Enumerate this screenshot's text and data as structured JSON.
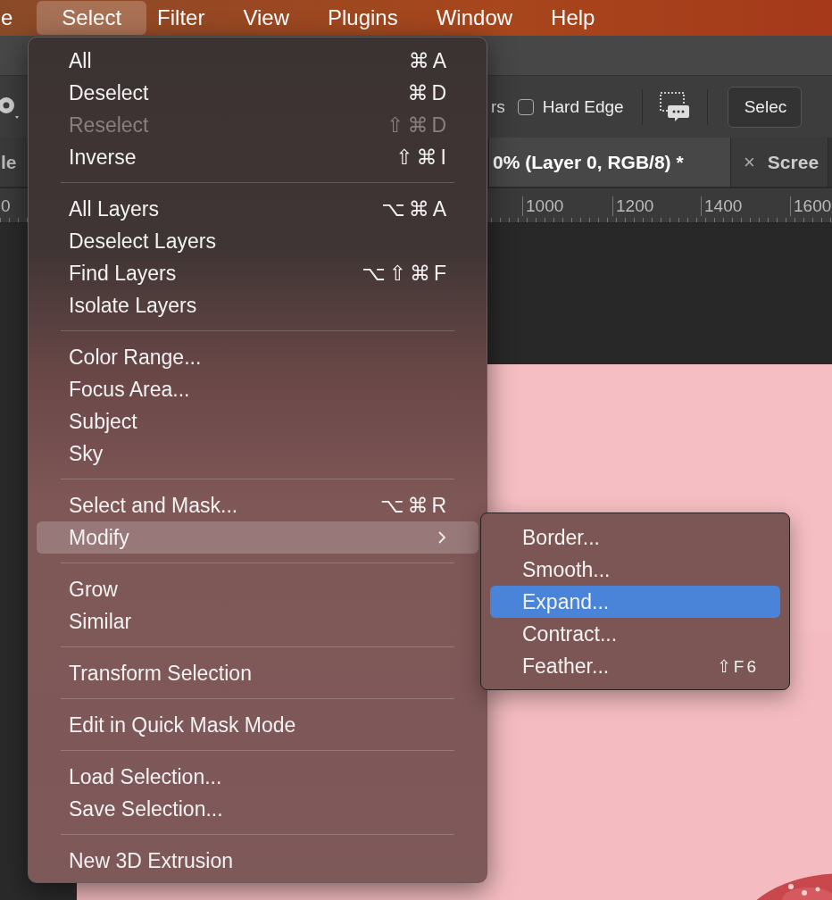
{
  "menu_bar": [
    {
      "label": "e",
      "selected": false
    },
    {
      "label": "Select",
      "selected": true
    },
    {
      "label": "Filter",
      "selected": false
    },
    {
      "label": "View",
      "selected": false
    },
    {
      "label": "Plugins",
      "selected": false
    },
    {
      "label": "Window",
      "selected": false
    },
    {
      "label": "Help",
      "selected": false
    }
  ],
  "options_bar": {
    "partial_label": "rs",
    "hard_edge": {
      "label": "Hard Edge",
      "checked": false
    },
    "button": "Selec"
  },
  "document_tabs": [
    {
      "label": "le",
      "selected": false
    },
    {
      "label": "0% (Layer 0, RGB/8) *",
      "selected": true
    },
    {
      "label": "Scree",
      "selected": false,
      "close": "×"
    }
  ],
  "ruler": [
    "0",
    "1000",
    "1200",
    "1400",
    "1600"
  ],
  "select_menu": [
    [
      {
        "label": "All",
        "shortcut": "⌘A",
        "disabled": false,
        "selected": false,
        "submenu": false
      },
      {
        "label": "Deselect",
        "shortcut": "⌘D",
        "disabled": false,
        "selected": false,
        "submenu": false
      },
      {
        "label": "Reselect",
        "shortcut": "⇧⌘D",
        "disabled": true,
        "selected": false,
        "submenu": false
      },
      {
        "label": "Inverse",
        "shortcut": "⇧⌘I",
        "disabled": false,
        "selected": false,
        "submenu": false
      }
    ],
    [
      {
        "label": "All Layers",
        "shortcut": "⌥⌘A",
        "disabled": false,
        "selected": false,
        "submenu": false
      },
      {
        "label": "Deselect Layers",
        "disabled": false,
        "selected": false,
        "submenu": false
      },
      {
        "label": "Find Layers",
        "shortcut": "⌥⇧⌘F",
        "disabled": false,
        "selected": false,
        "submenu": false
      },
      {
        "label": "Isolate Layers",
        "disabled": false,
        "selected": false,
        "submenu": false
      }
    ],
    [
      {
        "label": "Color Range...",
        "disabled": false,
        "selected": false,
        "submenu": false
      },
      {
        "label": "Focus Area...",
        "disabled": false,
        "selected": false,
        "submenu": false
      },
      {
        "label": "Subject",
        "disabled": false,
        "selected": false,
        "submenu": false
      },
      {
        "label": "Sky",
        "disabled": false,
        "selected": false,
        "submenu": false
      }
    ],
    [
      {
        "label": "Select and Mask...",
        "shortcut": "⌥⌘R",
        "disabled": false,
        "selected": false,
        "submenu": false
      },
      {
        "label": "Modify",
        "disabled": false,
        "selected": true,
        "submenu": true
      }
    ],
    [
      {
        "label": "Grow",
        "disabled": false,
        "selected": false,
        "submenu": false
      },
      {
        "label": "Similar",
        "disabled": false,
        "selected": false,
        "submenu": false
      }
    ],
    [
      {
        "label": "Transform Selection",
        "disabled": false,
        "selected": false,
        "submenu": false
      }
    ],
    [
      {
        "label": "Edit in Quick Mask Mode",
        "disabled": false,
        "selected": false,
        "submenu": false
      }
    ],
    [
      {
        "label": "Load Selection...",
        "disabled": false,
        "selected": false,
        "submenu": false
      },
      {
        "label": "Save Selection...",
        "disabled": false,
        "selected": false,
        "submenu": false
      }
    ],
    [
      {
        "label": "New 3D Extrusion",
        "disabled": false,
        "selected": false,
        "submenu": false
      }
    ]
  ],
  "modify_submenu": [
    {
      "label": "Border...",
      "selected": false
    },
    {
      "label": "Smooth...",
      "selected": false
    },
    {
      "label": "Expand...",
      "selected": true
    },
    {
      "label": "Contract...",
      "selected": false
    },
    {
      "label": "Feather...",
      "selected": false,
      "shortcut": "⇧F6"
    }
  ]
}
